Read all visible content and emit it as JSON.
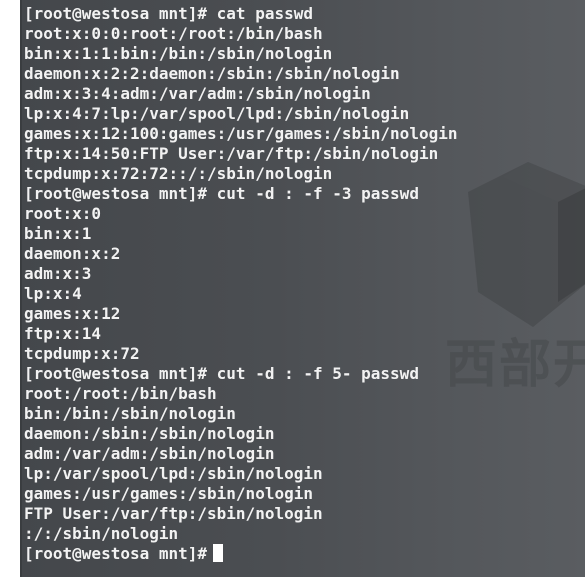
{
  "terminal": {
    "lines": [
      "[root@westosa mnt]# cat passwd",
      "root:x:0:0:root:/root:/bin/bash",
      "bin:x:1:1:bin:/bin:/sbin/nologin",
      "daemon:x:2:2:daemon:/sbin:/sbin/nologin",
      "adm:x:3:4:adm:/var/adm:/sbin/nologin",
      "lp:x:4:7:lp:/var/spool/lpd:/sbin/nologin",
      "games:x:12:100:games:/usr/games:/sbin/nologin",
      "ftp:x:14:50:FTP User:/var/ftp:/sbin/nologin",
      "tcpdump:x:72:72::/:/sbin/nologin",
      "[root@westosa mnt]# cut -d : -f -3 passwd",
      "root:x:0",
      "bin:x:1",
      "daemon:x:2",
      "adm:x:3",
      "lp:x:4",
      "games:x:12",
      "ftp:x:14",
      "tcpdump:x:72",
      "[root@westosa mnt]# cut -d : -f 5- passwd",
      "root:/root:/bin/bash",
      "bin:/bin:/sbin/nologin",
      "daemon:/sbin:/sbin/nologin",
      "adm:/var/adm:/sbin/nologin",
      "lp:/var/spool/lpd:/sbin/nologin",
      "games:/usr/games:/sbin/nologin",
      "FTP User:/var/ftp:/sbin/nologin",
      ":/:/sbin/nologin"
    ],
    "prompt": "[root@westosa mnt]#"
  },
  "watermark": {
    "text": "西部开",
    "icon": "logo-mark"
  }
}
